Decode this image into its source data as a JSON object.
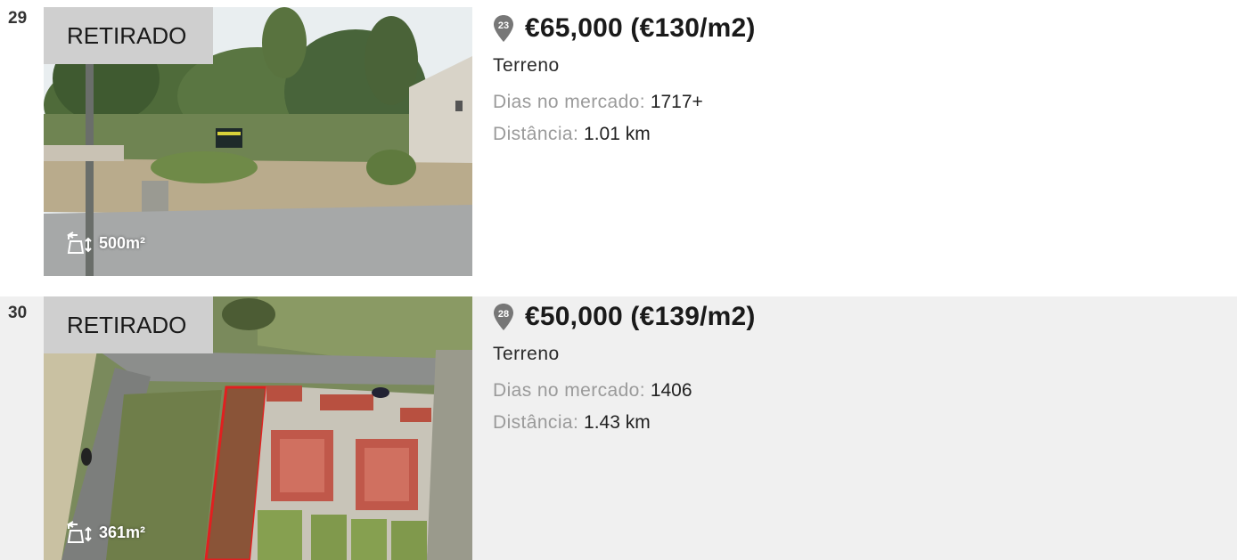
{
  "listings": [
    {
      "index": "29",
      "status": "RETIRADO",
      "area": "500m²",
      "map_marker": "23",
      "price": "€65,000 (€130/m2)",
      "type": "Terreno",
      "days_label": "Dias no mercado:",
      "days_value": "1717+",
      "distance_label": "Distância:",
      "distance_value": "1.01 km",
      "photo": "land-plot-with-pine-trees-photo"
    },
    {
      "index": "30",
      "status": "RETIRADO",
      "area": "361m²",
      "map_marker": "28",
      "price": "€50,000 (€139/m2)",
      "type": "Terreno",
      "days_label": "Dias no mercado:",
      "days_value": "1406",
      "distance_label": "Distância:",
      "distance_value": "1.43 km",
      "photo": "aerial-plot-outline-photo"
    }
  ],
  "colors": {
    "badge_bg": "#cfcfcf",
    "marker": "#777777",
    "alt_row_bg": "#f0f0f0",
    "plot_outline": "#e02020"
  },
  "icons": {
    "area": "area-resize-icon",
    "marker": "map-pin-icon"
  }
}
